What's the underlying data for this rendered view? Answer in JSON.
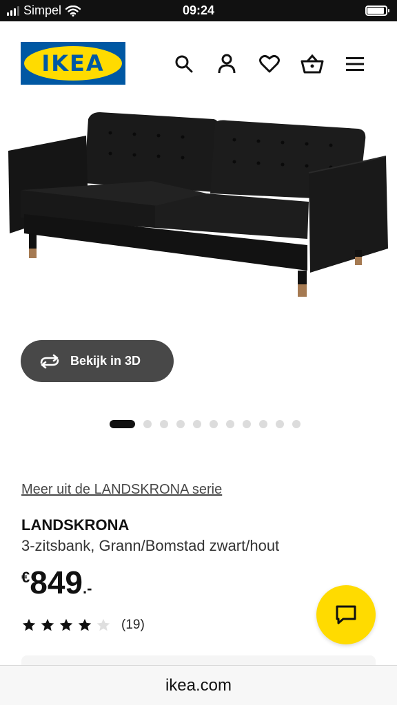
{
  "status_bar": {
    "carrier": "Simpel",
    "time": "09:24",
    "battery_level": 0.92
  },
  "header": {
    "logo_text": "IKEA",
    "icons": [
      "search-icon",
      "account-icon",
      "heart-icon",
      "basket-icon",
      "menu-icon"
    ]
  },
  "gallery": {
    "view_3d_label": "Bekijk in 3D",
    "image_count": 11,
    "active_index": 0
  },
  "product": {
    "series_link": "Meer uit de LANDSKRONA serie",
    "name": "LANDSKRONA",
    "description": "3-zitsbank, Grann/Bomstad zwart/hout",
    "price_currency": "€",
    "price_amount": "849",
    "price_suffix": ".-",
    "rating_value": 4,
    "rating_max": 5,
    "rating_count": "(19)"
  },
  "browser": {
    "url": "ikea.com"
  },
  "colors": {
    "brand_blue": "#0058a3",
    "brand_yellow": "#ffdb00",
    "button_dark": "#484848"
  }
}
